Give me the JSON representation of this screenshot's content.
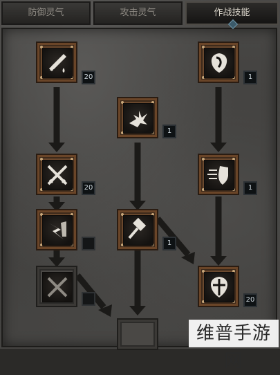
{
  "tabs": [
    {
      "label": "防御灵气",
      "active": false
    },
    {
      "label": "攻击灵气",
      "active": false
    },
    {
      "label": "作战技能",
      "active": true
    }
  ],
  "skills": {
    "sacrifice": {
      "icon": "sword-drop-icon",
      "rank": "20"
    },
    "holy_shield": {
      "icon": "shield-icon",
      "rank": "1"
    },
    "zeal": {
      "icon": "fist-burst-icon",
      "rank": "1"
    },
    "vengeance": {
      "icon": "crossed-swords-icon",
      "rank": "20"
    },
    "charge": {
      "icon": "shield-charge-icon",
      "rank": "1"
    },
    "blessed_hammer": {
      "icon": "hammer-icon",
      "rank": "1"
    },
    "conversion": {
      "icon": "lightning-icon",
      "rank": ""
    },
    "fist_heavens": {
      "icon": "sword-cross-icon",
      "rank": ""
    },
    "shield_cross": {
      "icon": "cross-shield-icon",
      "rank": "20"
    }
  },
  "watermark": "维普手游网",
  "colors": {
    "frame": "#7a5334",
    "rank_bg": "#0e1214",
    "accent": "#6f93a5"
  }
}
